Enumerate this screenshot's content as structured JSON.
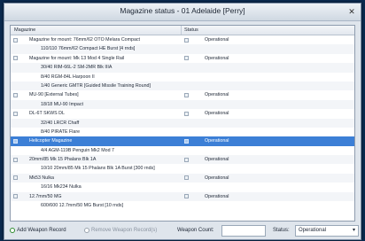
{
  "window": {
    "title": "Magazine status - 01 Adelaide [Perry]",
    "close_glyph": "✕"
  },
  "table": {
    "columns": {
      "magazine": "Magazine",
      "status": "Status"
    },
    "rows": [
      {
        "kind": "parent",
        "label": "Magazine for mount: 76mm/62 OTO Melara Compact",
        "status": "Operational"
      },
      {
        "kind": "child",
        "label": "110/110 76mm/62 Compact HE Burst [4 rnds]",
        "status": ""
      },
      {
        "kind": "parent",
        "label": "Magazine for mount: Mk 13 Mod 4 Single Rail",
        "status": "Operational"
      },
      {
        "kind": "child",
        "label": "30/40 RIM-66L-2 SM-2MR Blk IIIA",
        "status": ""
      },
      {
        "kind": "child",
        "label": "8/40 RGM-84L Harpoon II",
        "status": ""
      },
      {
        "kind": "child",
        "label": "1/40 Generic GMTR [Guided Missile Training Round]",
        "status": ""
      },
      {
        "kind": "parent",
        "label": "MU-90 [External Tubes]",
        "status": "Operational"
      },
      {
        "kind": "child",
        "label": "18/18 MU-90 Impact",
        "status": ""
      },
      {
        "kind": "parent",
        "label": "DL-6T SKWS DL",
        "status": "Operational"
      },
      {
        "kind": "child",
        "label": "32/40 LRCR Chaff",
        "status": ""
      },
      {
        "kind": "child",
        "label": "8/40 PIRATE Flare",
        "status": ""
      },
      {
        "kind": "parent",
        "label": "Helicopter Magazine",
        "status": "Operational",
        "selected": true
      },
      {
        "kind": "child",
        "label": "4/4 AGM-119B Penguin Mk2 Mod 7",
        "status": ""
      },
      {
        "kind": "parent",
        "label": "20mm/85 Mk 15 Phalanx Blk 1A",
        "status": "Operational"
      },
      {
        "kind": "child",
        "label": "10/10 20mm/85 Mk 15 Phalanx Blk 1A Burst [300 rnds]",
        "status": ""
      },
      {
        "kind": "parent",
        "label": "Mk53 Nulka",
        "status": "Operational"
      },
      {
        "kind": "child",
        "label": "16/16 Mk234 Nulka",
        "status": ""
      },
      {
        "kind": "parent",
        "label": "12.7mm/50 MG",
        "status": "Operational"
      },
      {
        "kind": "child",
        "label": "600/600 12.7mm/50 MG Burst [10 rnds]",
        "status": ""
      }
    ]
  },
  "footer": {
    "add_label": "Add Weapon Record",
    "remove_label": "Remove Weapon Record(s)",
    "count_label": "Weapon Count:",
    "count_value": "",
    "status_label": "Status:",
    "status_value": "Operational",
    "caret_glyph": "▾"
  },
  "colors": {
    "selection": "#3c7fd6",
    "add_icon": "#2e8b2e",
    "background": "#0b2a4f"
  }
}
